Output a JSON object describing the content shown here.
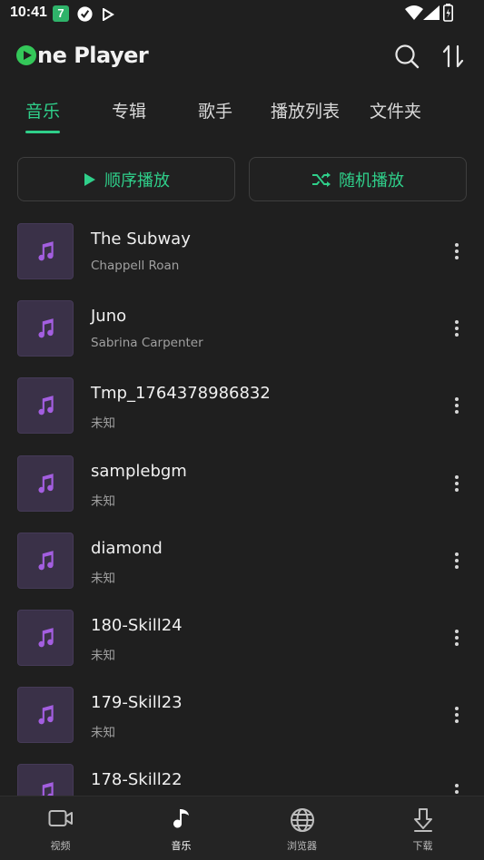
{
  "status_bar": {
    "time": "10:41",
    "app_badge": "7"
  },
  "app": {
    "logo_text": "ne Player",
    "accent_color": "#2fcf8a",
    "logo_green": "#34c759"
  },
  "tabs": [
    {
      "label": "音乐",
      "active": true
    },
    {
      "label": "专辑",
      "active": false
    },
    {
      "label": "歌手",
      "active": false
    },
    {
      "label": "播放列表",
      "active": false
    },
    {
      "label": "文件夹",
      "active": false
    }
  ],
  "actions": {
    "sequential_play": "顺序播放",
    "shuffle_play": "随机播放"
  },
  "songs": [
    {
      "title": "The Subway",
      "artist": "Chappell Roan"
    },
    {
      "title": "Juno",
      "artist": "Sabrina Carpenter"
    },
    {
      "title": "Tmp_1764378986832",
      "artist": "未知"
    },
    {
      "title": "samplebgm",
      "artist": "未知"
    },
    {
      "title": "diamond",
      "artist": "未知"
    },
    {
      "title": "180-Skill24",
      "artist": "未知"
    },
    {
      "title": "179-Skill23",
      "artist": "未知"
    },
    {
      "title": "178-Skill22",
      "artist": ""
    }
  ],
  "bottom_nav": [
    {
      "label": "视频",
      "icon": "video-camera-icon",
      "active": false
    },
    {
      "label": "音乐",
      "icon": "music-note-icon",
      "active": true
    },
    {
      "label": "浏览器",
      "icon": "globe-icon",
      "active": false
    },
    {
      "label": "下载",
      "icon": "download-icon",
      "active": false
    }
  ]
}
